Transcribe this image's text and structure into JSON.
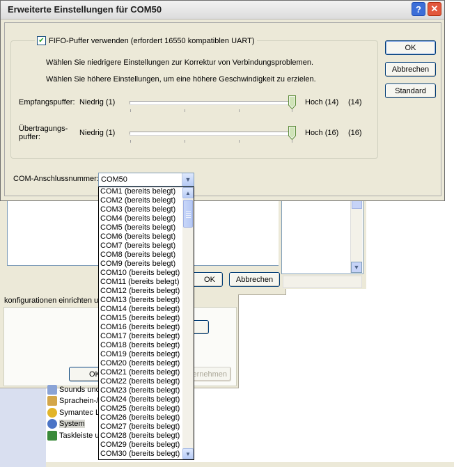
{
  "dialog": {
    "title": "Erweiterte Einstellungen für COM50",
    "help_symbol": "?",
    "close_symbol": "✕",
    "fifo_label": "FIFO-Puffer verwenden (erfordert 16550 kompatiblen UART)",
    "fifo_checked": true,
    "hint_low": "Wählen Sie niedrigere Einstellungen zur Korrektur von Verbindungsproblemen.",
    "hint_high": "Wählen Sie höhere Einstellungen, um eine höhere Geschwindigkeit zu erzielen.",
    "receive": {
      "label": "Empfangspuffer:",
      "low": "Niedrig (1)",
      "high": "Hoch (14)",
      "value": "(14)",
      "level": 1.0
    },
    "transmit": {
      "label_line1": "Übertragungs-",
      "label_line2": "puffer:",
      "low": "Niedrig (1)",
      "high": "Hoch (16)",
      "value": "(16)",
      "level": 1.0
    },
    "port_label": "COM-Anschlussnummer:",
    "port_value": "COM50",
    "buttons": {
      "ok": "OK",
      "cancel": "Abbrechen",
      "standard": "Standard"
    }
  },
  "dropdown_items": [
    "COM1 (bereits belegt)",
    "COM2 (bereits belegt)",
    "COM3 (bereits belegt)",
    "COM4 (bereits belegt)",
    "COM5 (bereits belegt)",
    "COM6 (bereits belegt)",
    "COM7 (bereits belegt)",
    "COM8 (bereits belegt)",
    "COM9 (bereits belegt)",
    "COM10 (bereits belegt)",
    "COM11 (bereits belegt)",
    "COM12 (bereits belegt)",
    "COM13 (bereits belegt)",
    "COM14 (bereits belegt)",
    "COM15 (bereits belegt)",
    "COM16 (bereits belegt)",
    "COM17 (bereits belegt)",
    "COM18 (bereits belegt)",
    "COM19 (bereits belegt)",
    "COM20 (bereits belegt)",
    "COM21 (bereits belegt)",
    "COM22 (bereits belegt)",
    "COM23 (bereits belegt)",
    "COM24 (bereits belegt)",
    "COM25 (bereits belegt)",
    "COM26 (bereits belegt)",
    "COM27 (bereits belegt)",
    "COM28 (bereits belegt)",
    "COM29 (bereits belegt)",
    "COM30 (bereits belegt)"
  ],
  "background": {
    "window1_buttons": {
      "ok_partial": "OK",
      "cancel": "Abbrechen"
    },
    "window2_text": "konfigurationen einrichten u",
    "window2_buttons": {
      "ok_partial": "OK",
      "apply_partial": "ernehmen"
    },
    "tree_items": [
      "Sounds und",
      "Sprachein-/",
      "Symantec L",
      "System",
      "Taskleiste u"
    ]
  }
}
